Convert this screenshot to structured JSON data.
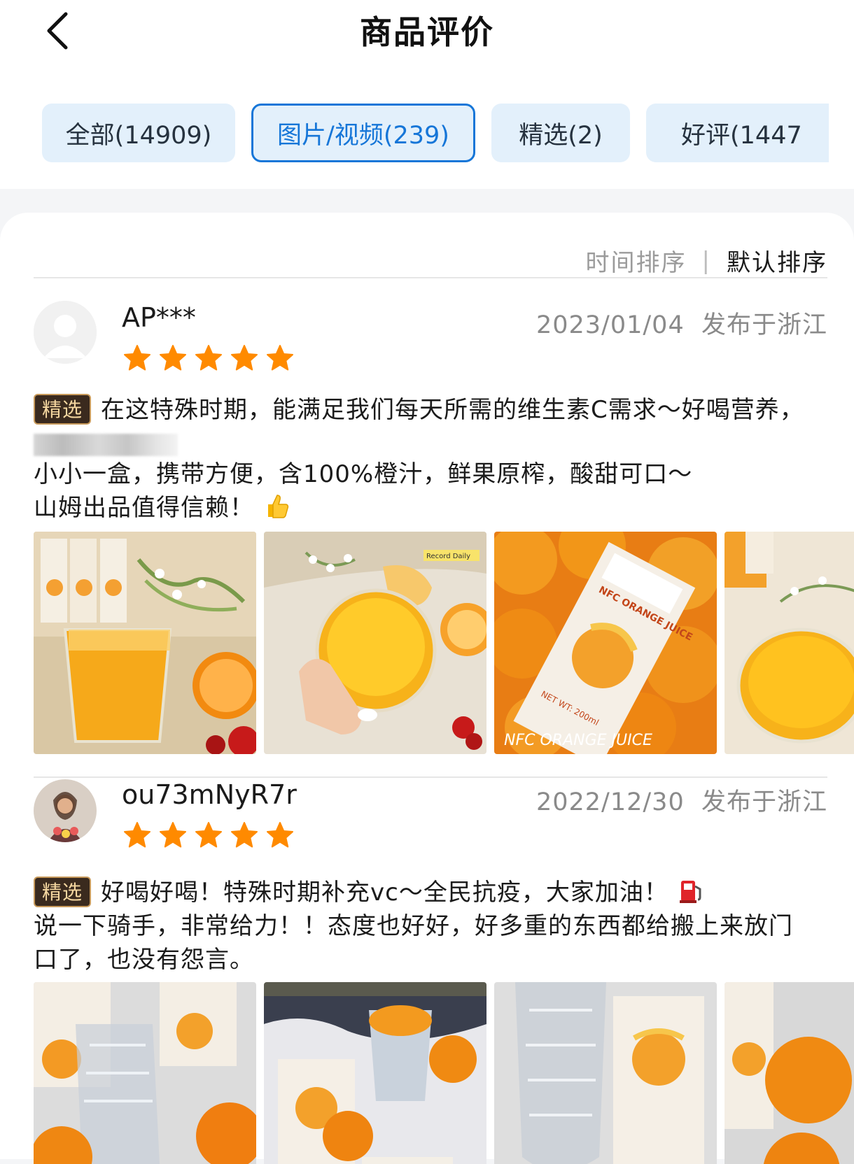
{
  "header": {
    "title": "商品评价",
    "back_icon": "chevron-left-icon"
  },
  "tabs": [
    {
      "label": "全部(14909)",
      "active": false
    },
    {
      "label": "图片/视频(239)",
      "active": true
    },
    {
      "label": "精选(2)",
      "active": false
    },
    {
      "label": "好评(1447",
      "active": false
    }
  ],
  "sort": {
    "time": "时间排序",
    "separator": "|",
    "default": "默认排序"
  },
  "reviews": [
    {
      "user": "AP***",
      "date": "2023/01/04",
      "location": "发布于浙江",
      "rating": 5,
      "badge": "精选",
      "line1": "在这特殊时期，能满足我们每天所需的维生素C需求～好喝营养，",
      "line2": "小小一盒，携带方便，含100%橙汁，鲜果原榨，酸甜可口～",
      "line3": "山姆出品值得信赖！",
      "emoji": "thumbs-up-icon",
      "photo_texts": {
        "record": "Record Daily",
        "carton_brand": "NFC ORANGE JUICE",
        "script": "NFC ORANGE JUICE",
        "net": "NET WT: 200ml"
      }
    },
    {
      "user": "ou73mNyR7r",
      "date": "2022/12/30",
      "location": "发布于浙江",
      "rating": 5,
      "badge": "精选",
      "line1": "好喝好喝！特殊时期补充vc～全民抗疫，大家加油！",
      "line2": "说一下骑手，非常给力！！态度也好好，好多重的东西都给搬上来放门",
      "line3": "口了，也没有怨言。",
      "emoji": "fuel-pump-icon"
    }
  ],
  "colors": {
    "accent": "#1676d8",
    "tab_bg": "#e3f0fb",
    "star": "#ff8a00",
    "badge_bg": "#3a2a1e"
  }
}
